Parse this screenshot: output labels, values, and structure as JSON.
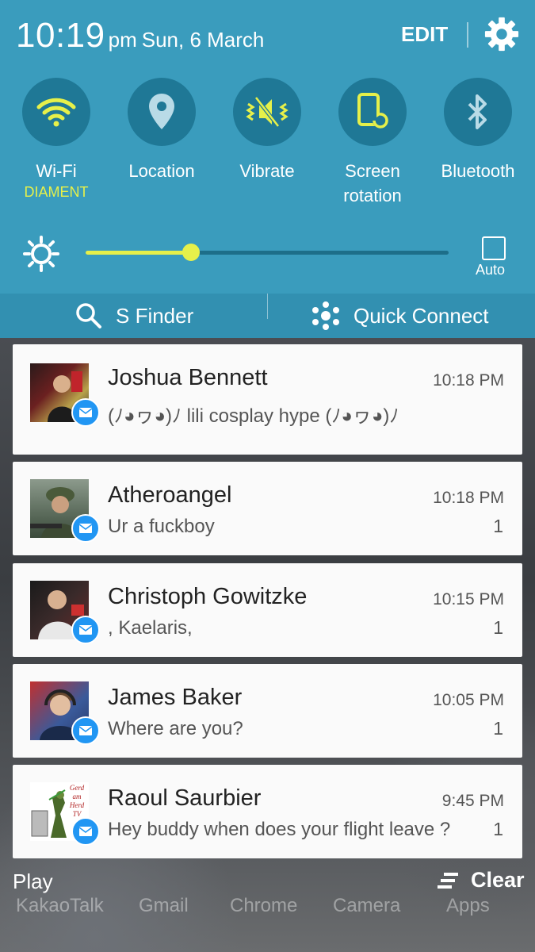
{
  "status": {
    "time": "10:19",
    "ampm": "pm",
    "date": "Sun, 6 March",
    "edit_label": "EDIT"
  },
  "quick_toggles": [
    {
      "label": "Wi-Fi",
      "sub": "DIAMENT",
      "icon": "wifi-icon",
      "active": true
    },
    {
      "label": "Location",
      "sub": "",
      "icon": "location-pin-icon",
      "active": false
    },
    {
      "label": "Vibrate",
      "sub": "",
      "icon": "vibrate-icon",
      "active": true
    },
    {
      "label": "Screen rotation",
      "sub": "",
      "icon": "screen-rotation-icon",
      "active": true
    },
    {
      "label": "Bluetooth",
      "sub": "",
      "icon": "bluetooth-icon",
      "active": false
    }
  ],
  "brightness": {
    "level": 0.29,
    "auto_label": "Auto",
    "auto_checked": false
  },
  "finder_bar": {
    "s_finder": "S Finder",
    "quick_connect": "Quick Connect"
  },
  "notifications": [
    {
      "sender": "Joshua Bennett",
      "time": "10:18 PM",
      "message": "(ﾉ◕ヮ◕)ﾉ lili cosplay hype (ﾉ◕ヮ◕)ﾉ",
      "count": ""
    },
    {
      "sender": "Atheroangel",
      "time": "10:18 PM",
      "message": "Ur a fuckboy",
      "count": "1"
    },
    {
      "sender": "Christoph Gowitzke",
      "time": "10:15 PM",
      "message": ", Kaelaris,",
      "count": "1"
    },
    {
      "sender": "James Baker",
      "time": "10:05 PM",
      "message": "Where are you?",
      "count": "1"
    },
    {
      "sender": "Raoul Saurbier",
      "time": "9:45 PM",
      "message": "Hey buddy when does your flight leave ?",
      "count": "1",
      "avatar_text": "Gerd am Herd TV"
    }
  ],
  "dock": {
    "play_label": "Play",
    "clear_label": "Clear",
    "apps": [
      "KakaoTalk",
      "Gmail",
      "Chrome",
      "Camera",
      "Apps"
    ]
  },
  "colors": {
    "panel": "#3a9cbd",
    "toggle_circle": "#1f7896",
    "accent_active": "#e6f04a",
    "inactive_icon": "#b9dbe7",
    "badge": "#2196f3"
  }
}
